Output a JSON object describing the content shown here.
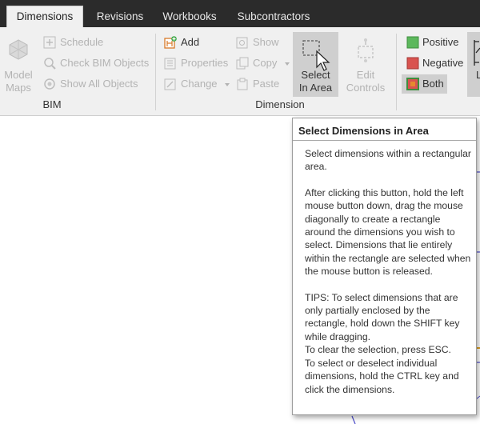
{
  "tabs": [
    {
      "label": "Dimensions",
      "active": true
    },
    {
      "label": "Revisions",
      "active": false
    },
    {
      "label": "Workbooks",
      "active": false
    },
    {
      "label": "Subcontractors",
      "active": false
    }
  ],
  "ribbon": {
    "bim": {
      "title": "BIM",
      "model_maps": "Model\nMaps",
      "schedule": "Schedule",
      "check_bim": "Check BIM Objects",
      "show_all": "Show All Objects"
    },
    "dimension": {
      "title": "Dimension",
      "add": "Add",
      "properties": "Properties",
      "change": "Change",
      "show": "Show",
      "copy": "Copy",
      "paste": "Paste",
      "select_in_area": "Select\nIn Area",
      "edit_controls": "Edit\nControls"
    },
    "filters": {
      "positive": "Positive",
      "negative": "Negative",
      "both": "Both"
    },
    "cut_label": "L"
  },
  "tooltip": {
    "title": "Select Dimensions in Area",
    "p1": "Select dimensions within a rectangular area.",
    "p2": "After clicking this button, hold the left mouse button down, drag the mouse diagonally to create a rectangle around the dimensions you wish to select. Dimensions that lie entirely within the rectangle are selected when the mouse button is released.",
    "p3": "TIPS: To select dimensions that are only partially enclosed by the rectangle, hold down the SHIFT key while dragging.",
    "p4": "To clear the selection, press ESC.",
    "p5": "To select or deselect individual dimensions, hold the CTRL key and click the dimensions."
  },
  "colors": {
    "positive": "#5cb85c",
    "negative": "#d9534f",
    "both": "#e58a2e",
    "tabbar": "#2b2b2b"
  }
}
